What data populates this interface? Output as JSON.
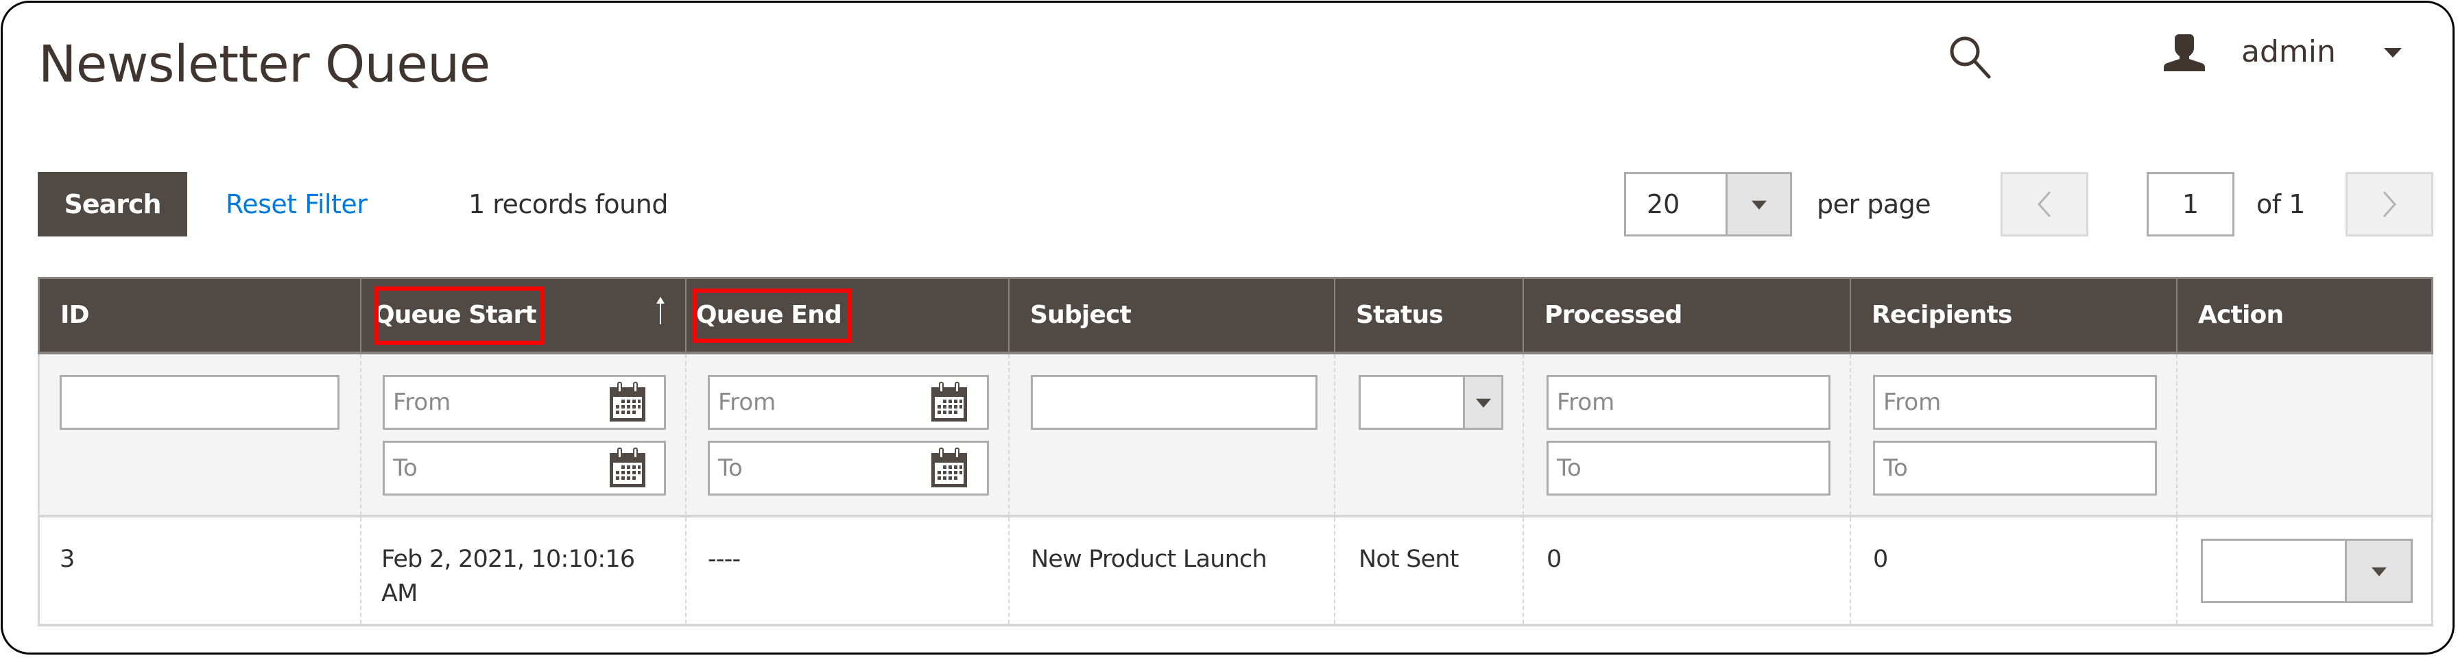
{
  "header": {
    "title": "Newsletter Queue",
    "search_icon": "search-icon",
    "user_icon": "user-icon",
    "user_name": "admin"
  },
  "toolbar": {
    "search_label": "Search",
    "reset_label": "Reset Filter",
    "records_text": "1 records found",
    "per_page_value": "20",
    "per_page_label": "per page",
    "current_page": "1",
    "page_total_text": "of 1"
  },
  "grid": {
    "columns": [
      {
        "label": "ID"
      },
      {
        "label": "Queue Start",
        "sorted": "ascending",
        "highlighted": true
      },
      {
        "label": "Queue End",
        "highlighted": true
      },
      {
        "label": "Subject"
      },
      {
        "label": "Status"
      },
      {
        "label": "Processed"
      },
      {
        "label": "Recipients"
      },
      {
        "label": "Action"
      }
    ],
    "filters": {
      "id": "",
      "queue_start_from_placeholder": "From",
      "queue_start_to_placeholder": "To",
      "queue_end_from_placeholder": "From",
      "queue_end_to_placeholder": "To",
      "subject": "",
      "status": "",
      "processed_from_placeholder": "From",
      "processed_to_placeholder": "To",
      "recipients_from_placeholder": "From",
      "recipients_to_placeholder": "To"
    },
    "rows": [
      {
        "id": "3",
        "queue_start_line1": "Feb 2, 2021, 10:10:16",
        "queue_start_line2": "AM",
        "queue_end": "----",
        "subject": "New Product Launch",
        "status": "Not Sent",
        "processed": "0",
        "recipients": "0",
        "action": ""
      }
    ]
  },
  "colors": {
    "header_bg": "#514943",
    "link": "#007bdb",
    "highlight": "#ff0000"
  }
}
